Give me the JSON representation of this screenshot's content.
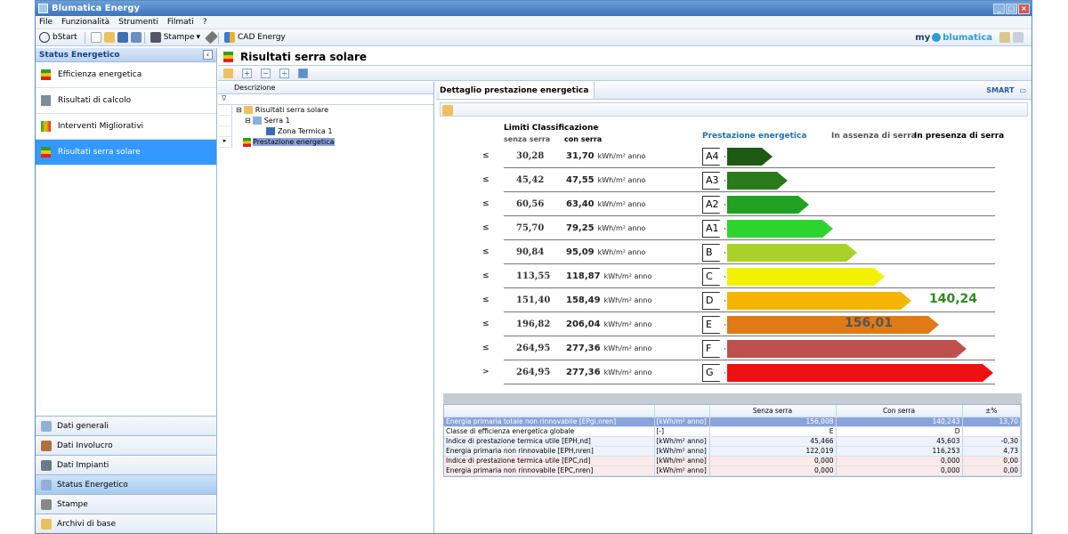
{
  "window": {
    "title": "Blumatica Energy"
  },
  "menu": [
    "File",
    "Funzionalità",
    "Strumenti",
    "Filmati",
    "?"
  ],
  "toolbar": {
    "bstart": "bStart",
    "stampe": "Stampe",
    "cad": "CAD Energy",
    "brand_my": "my",
    "brand_name": "blumatica"
  },
  "sidebar": {
    "header": "Status Energetico",
    "items": [
      {
        "label": "Efficienza energetica"
      },
      {
        "label": "Risultati di calcolo"
      },
      {
        "label": "Interventi Migliorativi"
      },
      {
        "label": "Risultati serra solare",
        "selected": true
      }
    ],
    "bottom": [
      {
        "label": "Dati generali"
      },
      {
        "label": "Dati Involucro"
      },
      {
        "label": "Dati Impianti"
      },
      {
        "label": "Status Energetico",
        "selected": true
      },
      {
        "label": "Stampe"
      },
      {
        "label": "Archivi di base"
      }
    ]
  },
  "main": {
    "title": "Risultati serra solare"
  },
  "tree": {
    "header": "Descrizione",
    "nodes": [
      {
        "label": "Risultati serra solare"
      },
      {
        "label": "Serra 1"
      },
      {
        "label": "Zona Termica 1"
      },
      {
        "label": "Prestazione energetica",
        "selected": true
      }
    ]
  },
  "detail": {
    "tab": "Dettaglio prestazione energetica",
    "limits_title": "Limiti Classificazione",
    "col_senza": "senza serra",
    "col_con": "con serra",
    "perf_header": "Prestazione energetica",
    "absent_header": "In assenza di serra",
    "present_header": "In presenza di serra",
    "unit": "kWh/m² anno",
    "rows": [
      {
        "sym": "≤",
        "senza": "30,28",
        "con": "31,70",
        "cls": "A4",
        "color": "#1e5a14",
        "len": 0.15
      },
      {
        "sym": "≤",
        "senza": "45,42",
        "con": "47,55",
        "cls": "A3",
        "color": "#2a7a1c",
        "len": 0.2
      },
      {
        "sym": "≤",
        "senza": "60,56",
        "con": "63,40",
        "cls": "A2",
        "color": "#21a021",
        "len": 0.27
      },
      {
        "sym": "≤",
        "senza": "75,70",
        "con": "79,25",
        "cls": "A1",
        "color": "#2ed42e",
        "len": 0.35
      },
      {
        "sym": "≤",
        "senza": "90,84",
        "con": "95,09",
        "cls": "B",
        "color": "#a8d22a",
        "len": 0.43
      },
      {
        "sym": "≤",
        "senza": "113,55",
        "con": "118,87",
        "cls": "C",
        "color": "#f2f200",
        "len": 0.52
      },
      {
        "sym": "≤",
        "senza": "151,40",
        "con": "158,49",
        "cls": "D",
        "color": "#f5b400",
        "len": 0.61,
        "in_presenza": "140,24"
      },
      {
        "sym": "≤",
        "senza": "196,82",
        "con": "206,04",
        "cls": "E",
        "color": "#e07a14",
        "len": 0.7,
        "in_assenza": "156,01"
      },
      {
        "sym": "≤",
        "senza": "264,95",
        "con": "277,36",
        "cls": "F",
        "color": "#c0504d",
        "len": 0.79
      },
      {
        "sym": ">",
        "senza": "264,95",
        "con": "277,36",
        "cls": "G",
        "color": "#ee1111",
        "len": 0.88
      }
    ],
    "present_color": "#2e8b22"
  },
  "grid": {
    "headers": [
      "",
      "",
      "Senza serra",
      "Con serra",
      "±%"
    ],
    "rows": [
      {
        "desc": "Energia primaria totale non rinnovabile [EPgl,nren]",
        "unit": "[kWh/m² anno]",
        "senza": "156,008",
        "con": "140,243",
        "pct": "13,70",
        "style": "sel"
      },
      {
        "desc": "Classe di efficienza energetica globale",
        "unit": "[-]",
        "senza": "E",
        "con": "D",
        "pct": "",
        "style": ""
      },
      {
        "desc": "Indice di prestazione termica utile [EPH,nd]",
        "unit": "[kWh/m² anno]",
        "senza": "45,466",
        "con": "45,603",
        "pct": "-0,30",
        "style": "blue"
      },
      {
        "desc": "Energia primaria non rinnovabile [EPH,nren]",
        "unit": "[kWh/m² anno]",
        "senza": "122,019",
        "con": "116,253",
        "pct": "4,73",
        "style": "blue"
      },
      {
        "desc": "Indice di prestazione termica utile [EPC,nd]",
        "unit": "[kWh/m² anno]",
        "senza": "0,000",
        "con": "0,000",
        "pct": "0,00",
        "style": "pink"
      },
      {
        "desc": "Energia primaria non rinnovabile [EPC,nren]",
        "unit": "[kWh/m² anno]",
        "senza": "0,000",
        "con": "0,000",
        "pct": "0,00",
        "style": "pink"
      }
    ]
  }
}
